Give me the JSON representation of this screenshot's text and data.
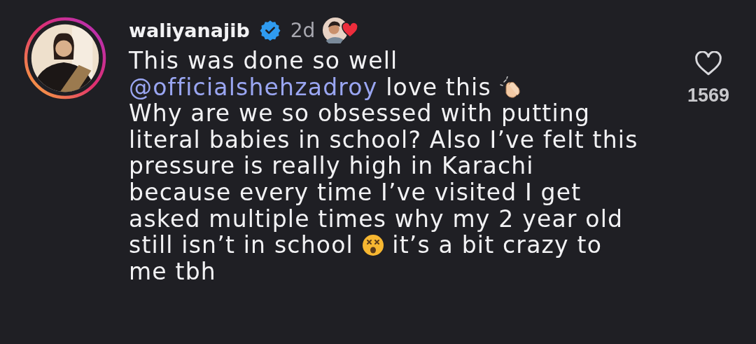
{
  "comment": {
    "username": "waliyanajib",
    "verified": true,
    "time": "2d",
    "liked_by_creator": true,
    "text": [
      {
        "kind": "text",
        "text": "This was done so well\n"
      },
      {
        "kind": "mention",
        "text": "@officialshehzadroy"
      },
      {
        "kind": "text",
        "text": " love this "
      },
      {
        "kind": "clap"
      },
      {
        "kind": "text",
        "text": "\nWhy are we so obsessed with putting literal babies in school? Also I’ve felt this pressure is really high in Karachi because every time I’ve visited I get asked multiple times why my 2 year old still isn’t in school "
      },
      {
        "kind": "dizzy"
      },
      {
        "kind": "text",
        "text": " it’s a bit crazy to me tbh"
      }
    ],
    "liked": false,
    "like_count": "1569"
  }
}
